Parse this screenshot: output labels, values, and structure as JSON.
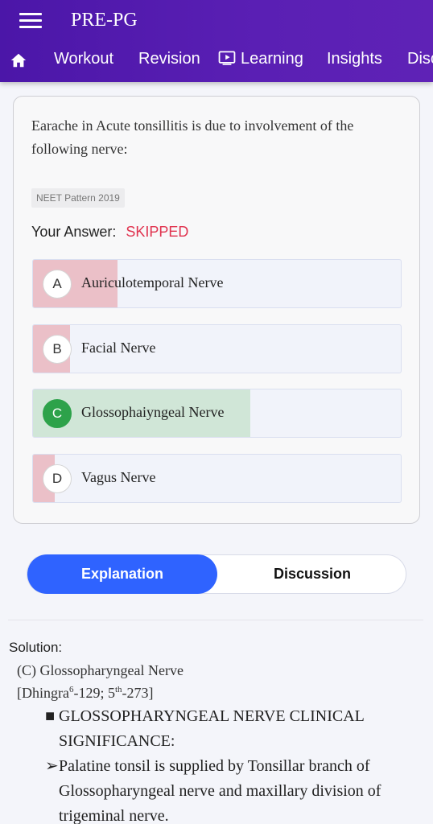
{
  "header": {
    "app_title": "PRE-PG",
    "tabs": [
      {
        "icon": "home-icon"
      },
      {
        "label": "Workout"
      },
      {
        "label": "Revision"
      },
      {
        "icon": "play-screen-icon",
        "label": "Learning"
      },
      {
        "label": "Insights"
      },
      {
        "label": "Disc"
      }
    ]
  },
  "question": {
    "text": "Earache in Acute tonsillitis is due to involvement of the following nerve:",
    "tag": "NEET Pattern 2019",
    "your_answer_label": "Your Answer:",
    "your_answer_value": "SKIPPED",
    "options": [
      {
        "letter": "A",
        "text": "Auriculotemporal Nerve",
        "response_fraction": 0.23,
        "correct": false
      },
      {
        "letter": "B",
        "text": "Facial Nerve",
        "response_fraction": 0.1,
        "correct": false
      },
      {
        "letter": "C",
        "text": "Glossophaiyngeal Nerve",
        "response_fraction": 0.59,
        "correct": true
      },
      {
        "letter": "D",
        "text": "Vagus Nerve",
        "response_fraction": 0.06,
        "correct": false
      }
    ]
  },
  "toggle": {
    "explanation": "Explanation",
    "discussion": "Discussion"
  },
  "solution": {
    "heading": "Solution:",
    "answer_line": "(C) Glossopharyngeal Nerve",
    "ref_prefix": "[Dhingra",
    "ref_sup1": "6",
    "ref_mid": "-129; 5",
    "ref_sup2": "th",
    "ref_suffix": "-273]",
    "bullet1": "GLOSSOPHARYNGEAL NERVE CLINICAL SIGNIFICANCE:",
    "bullet2": "Palatine tonsil is supplied by Tonsillar branch of Glossopharyngeal nerve and maxillary division of trigeminal nerve."
  },
  "colors": {
    "header": "#5a1fb4",
    "wrong_fill": "#ebc0c8",
    "correct_fill": "#d0e6d7",
    "correct_badge": "#2da24a",
    "skipped": "#e0334f",
    "toggle_active": "#2f63ff"
  }
}
